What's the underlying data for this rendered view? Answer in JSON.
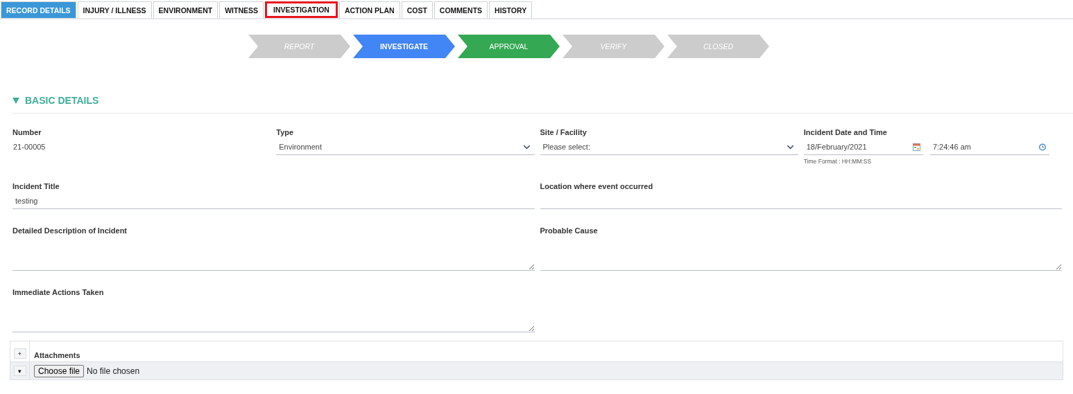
{
  "tabs": [
    {
      "label": "RECORD DETAILS",
      "selected": true,
      "highlighted": false
    },
    {
      "label": "INJURY / ILLNESS",
      "selected": false,
      "highlighted": false
    },
    {
      "label": "ENVIRONMENT",
      "selected": false,
      "highlighted": false
    },
    {
      "label": "WITNESS",
      "selected": false,
      "highlighted": false
    },
    {
      "label": "INVESTIGATION",
      "selected": false,
      "highlighted": true
    },
    {
      "label": "ACTION PLAN",
      "selected": false,
      "highlighted": false
    },
    {
      "label": "COST",
      "selected": false,
      "highlighted": false
    },
    {
      "label": "COMMENTS",
      "selected": false,
      "highlighted": false
    },
    {
      "label": "HISTORY",
      "selected": false,
      "highlighted": false
    }
  ],
  "stages": [
    {
      "label": "REPORT",
      "color": "#cccccc",
      "selected": false,
      "reached": false
    },
    {
      "label": "INVESTIGATE",
      "color": "#4285f4",
      "selected": true,
      "reached": true
    },
    {
      "label": "APPROVAL",
      "color": "#34a853",
      "selected": false,
      "reached": true
    },
    {
      "label": "VERIFY",
      "color": "#cccccc",
      "selected": false,
      "reached": false
    },
    {
      "label": "CLOSED",
      "color": "#cccccc",
      "selected": false,
      "reached": false
    }
  ],
  "section": {
    "title": "BASIC DETAILS",
    "expanded": true
  },
  "form_rows": [
    [
      {
        "kind": "static",
        "label": "Number",
        "value": "21-00005"
      },
      {
        "kind": "select",
        "label": "Type",
        "value": "Environment"
      },
      {
        "kind": "select",
        "label": "Site / Facility",
        "value": "Please select:"
      },
      {
        "kind": "datetime",
        "label": "Incident Date and Time",
        "date": "18/February/2021",
        "time": "7:24:46 am",
        "hint": "Time Format : HH:MM:SS"
      }
    ],
    [
      {
        "kind": "text",
        "label": "Incident Title",
        "value": "testing"
      },
      {
        "kind": "text",
        "label": "Location where event occurred"
      }
    ],
    [
      {
        "kind": "textarea",
        "label": "Detailed Description of Incident"
      },
      {
        "kind": "textarea",
        "label": "Probable Cause"
      }
    ],
    [
      {
        "kind": "textarea",
        "label": "Immediate Actions Taken"
      }
    ]
  ],
  "attachments": {
    "title": "Attachments",
    "add": "+",
    "toggle": "▾",
    "choose": "Choose file",
    "status": "No file chosen"
  }
}
